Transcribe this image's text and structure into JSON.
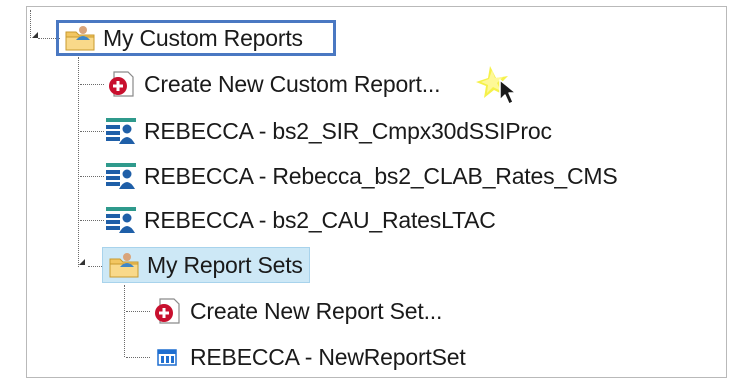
{
  "tree": {
    "root": {
      "label": "My Custom Reports",
      "icon": "folder-user-icon"
    },
    "items": [
      {
        "label": "Create New Custom Report...",
        "icon": "create-report-icon"
      },
      {
        "label": "REBECCA - bs2_SIR_Cmpx30dSSIProc",
        "icon": "report-icon"
      },
      {
        "label": "REBECCA - Rebecca_bs2_CLAB_Rates_CMS",
        "icon": "report-icon"
      },
      {
        "label": "REBECCA - bs2_CAU_RatesLTAC",
        "icon": "report-icon"
      }
    ],
    "report_sets": {
      "label": "My Report Sets",
      "icon": "folder-user-icon",
      "items": [
        {
          "label": "Create New Report Set...",
          "icon": "create-report-icon"
        },
        {
          "label": "REBECCA - NewReportSet",
          "icon": "report-set-icon"
        }
      ]
    }
  },
  "colors": {
    "highlight_border": "#4a78c2",
    "selected_bg": "#cde8f6",
    "red_icon": "#c8102e",
    "report_blue": "#1f5fa8",
    "report_teal": "#2f9a8c"
  }
}
